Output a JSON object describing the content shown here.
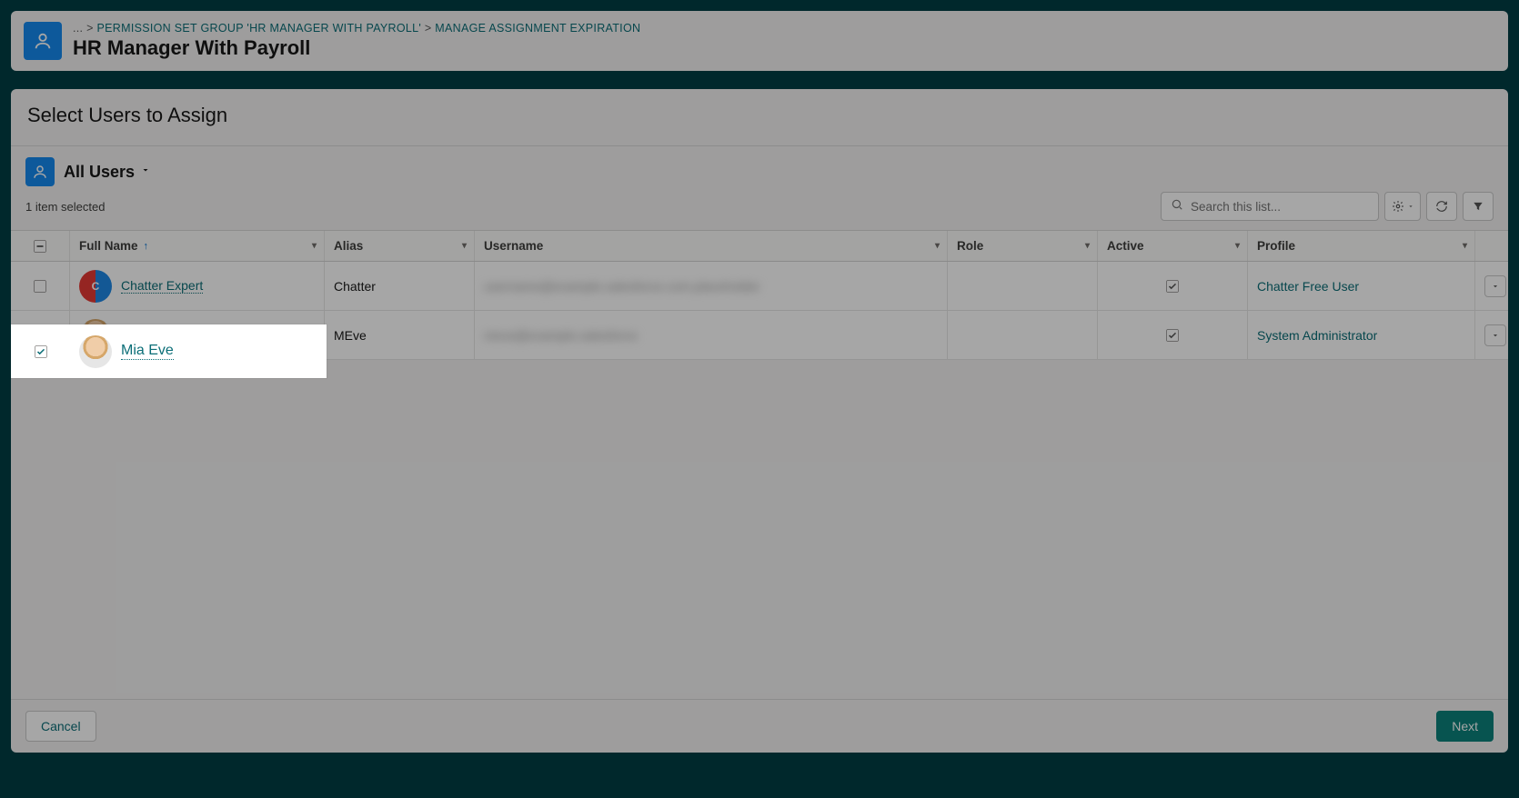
{
  "breadcrumb": {
    "ellipsis": "...",
    "sep": ">",
    "link1": "PERMISSION SET GROUP 'HR MANAGER WITH PAYROLL'",
    "link2": "MANAGE ASSIGNMENT EXPIRATION"
  },
  "page_title": "HR Manager With Payroll",
  "section_title": "Select Users to Assign",
  "list_view": {
    "name": "All Users",
    "selected_count": "1 item selected"
  },
  "search": {
    "placeholder": "Search this list..."
  },
  "columns": {
    "full_name": "Full Name",
    "alias": "Alias",
    "username": "Username",
    "role": "Role",
    "active": "Active",
    "profile": "Profile"
  },
  "rows": [
    {
      "checked": false,
      "full_name": "Chatter Expert",
      "alias": "Chatter",
      "username_masked": "username@example.salesforce.com.placeholder",
      "role": "",
      "active": true,
      "profile": "Chatter Free User"
    },
    {
      "checked": true,
      "full_name": "Mia Eve",
      "alias": "MEve",
      "username_masked": "meve@example.salesforce",
      "role": "",
      "active": true,
      "profile": "System Administrator"
    }
  ],
  "buttons": {
    "cancel": "Cancel",
    "next": "Next"
  }
}
